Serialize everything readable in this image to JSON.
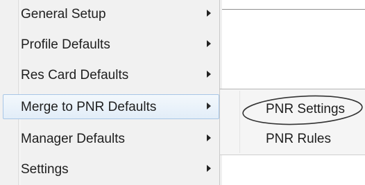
{
  "menu": {
    "items": [
      {
        "label": "General Setup",
        "has_submenu": true
      },
      {
        "label": "Profile Defaults",
        "has_submenu": true
      },
      {
        "label": "Res Card Defaults",
        "has_submenu": true
      },
      {
        "label": "Merge to PNR Defaults",
        "has_submenu": true,
        "highlighted": true
      },
      {
        "label": "Manager Defaults",
        "has_submenu": true
      },
      {
        "label": "Settings",
        "has_submenu": true
      }
    ]
  },
  "submenu": {
    "items": [
      {
        "label": "PNR Settings",
        "circled": true
      },
      {
        "label": "PNR Rules"
      }
    ]
  },
  "colors": {
    "menu_background": "#f1f1f1",
    "highlight_background": "#e2edf8",
    "highlight_border": "#a8c6e6",
    "text": "#1e1e1e"
  }
}
